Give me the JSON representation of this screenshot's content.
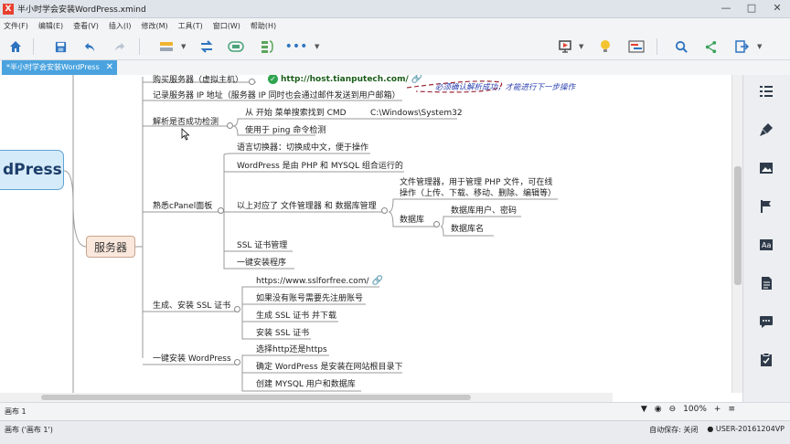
{
  "window": {
    "title": "半小时学会安装WordPress.xmind",
    "app_icon": "X"
  },
  "menu": [
    "文件(F)",
    "编辑(E)",
    "查看(V)",
    "插入(I)",
    "修改(M)",
    "工具(T)",
    "窗口(W)",
    "帮助(H)"
  ],
  "toolbar_icons": [
    "home-icon",
    "save-icon",
    "undo-icon",
    "redo-icon",
    "topic-icon",
    "relationship-icon",
    "boundary-icon",
    "summary-icon",
    "more-icon",
    "presentation-icon",
    "idea-icon",
    "gantt-icon",
    "search-icon",
    "share-icon",
    "export-icon"
  ],
  "doc_tab": {
    "label": "*半小时学会安装WordPress",
    "close": "✕"
  },
  "mindmap": {
    "central": "dPress",
    "branch": "服务器",
    "topics": {
      "buy_server": "购买服务器（虚拟主机）",
      "buy_server_url": "http://host.tianputech.com/",
      "record_ip": "记录服务器 IP 地址（服务器 IP 同时也会通过邮件发送到用户邮箱）",
      "check_resolve": "解析是否成功检测",
      "from_start": "从 开始 菜单搜索找到 CMD",
      "cmd_path": "C:\\Windows\\System32",
      "use_ping": "使用于 ping 命令检测",
      "cpanel": "熟悉cPanel面板",
      "lang_switch": "语言切换器：切换成中文，便于操作",
      "wp_php": "WordPress 是由 PHP 和 MYSQL 组合运行的",
      "file_db": "以上对应了 文件管理器 和 数据库管理",
      "file_manager_1": "文件管理器，用于管理 PHP 文件，可在线",
      "file_manager_2": "操作（上传、下载、移动、删除、编辑等）",
      "database": "数据库",
      "db_user": "数据库用户、密码",
      "db_name": "数据库名",
      "ssl_manage": "SSL 证书管理",
      "one_click": "一键安装程序",
      "gen_ssl": "生成、安装 SSL 证书",
      "ssl_url": "https://www.sslforfree.com/",
      "need_register": "如果没有账号需要先注册账号",
      "gen_download": "生成 SSL 证书 并下载",
      "install_ssl": "安装 SSL 证书",
      "install_wp": "一键安装 WordPress",
      "choose_http": "选择http还是https",
      "confirm_dir": "确定 WordPress 是安装在网站根目录下",
      "create_mysql": "创建 MYSQL 用户和数据库"
    },
    "annotation": "必须确认解析成功，才能进行下一步操作"
  },
  "sidebar_icons": [
    "outline-icon",
    "format-brush-icon",
    "image-icon",
    "flag-marker-icon",
    "text-style-icon",
    "notes-icon",
    "comment-icon",
    "task-icon"
  ],
  "sheetbar": {
    "sheet": "画布 1",
    "zoom": "100%",
    "filter": "▼",
    "eye": "◉",
    "minus": "⊖",
    "plus": "+",
    "menu": "≡"
  },
  "status": {
    "left": "画布 ('画布 1')",
    "autosave": "自动保存: 关闭",
    "user": "USER-20161204VP"
  }
}
